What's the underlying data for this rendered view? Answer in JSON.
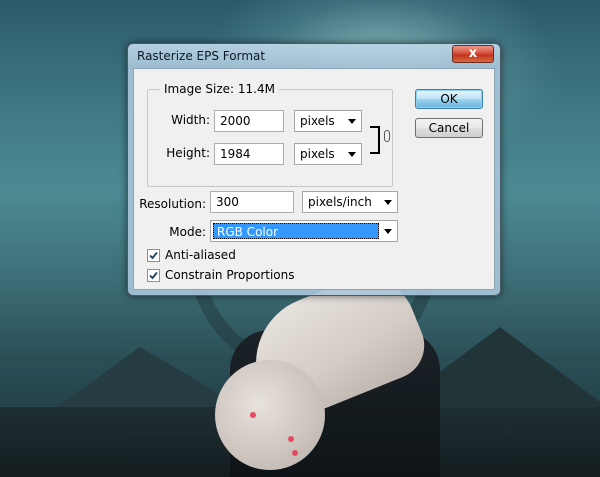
{
  "dialog": {
    "title": "Rasterize EPS Format",
    "close_glyph": "x",
    "image_size_label": "Image Size: 11.4M",
    "width": {
      "label": "Width:",
      "value": "2000",
      "unit": "pixels"
    },
    "height": {
      "label": "Height:",
      "value": "1984",
      "unit": "pixels"
    },
    "resolution": {
      "label": "Resolution:",
      "value": "300",
      "unit": "pixels/inch"
    },
    "mode": {
      "label": "Mode:",
      "value": "RGB Color"
    },
    "anti_aliased": {
      "label": "Anti-aliased",
      "checked": true
    },
    "constrain": {
      "label": "Constrain Proportions",
      "checked": true
    },
    "ok_label": "OK",
    "cancel_label": "Cancel",
    "link_icon": "chain-link-icon"
  },
  "colors": {
    "selection": "#3399ff",
    "close_button": "#c2331d",
    "default_button": "#68b3db"
  }
}
